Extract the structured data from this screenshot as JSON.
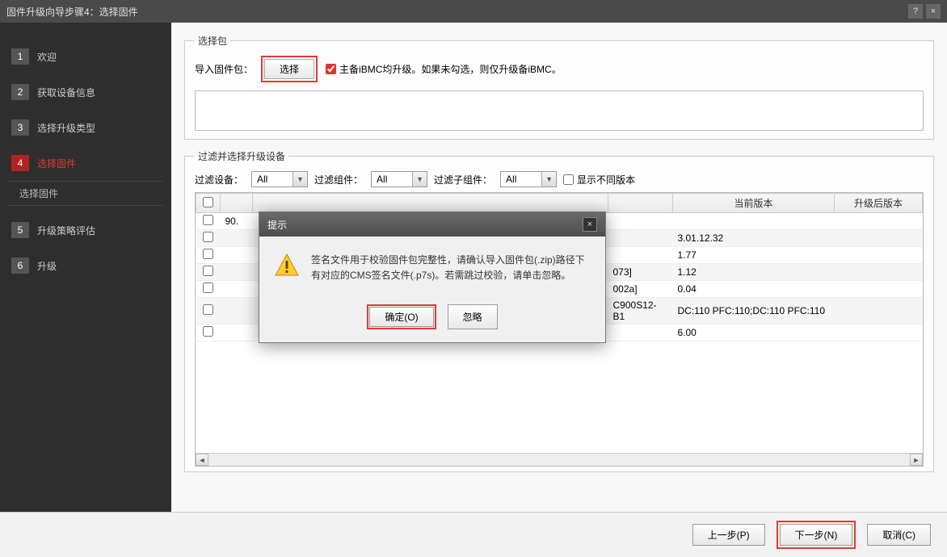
{
  "window": {
    "title": "固件升级向导步骤4：选择固件"
  },
  "sidebar": {
    "steps": [
      {
        "num": "1",
        "label": "欢迎"
      },
      {
        "num": "2",
        "label": "获取设备信息"
      },
      {
        "num": "3",
        "label": "选择升级类型"
      },
      {
        "num": "4",
        "label": "选择固件"
      },
      {
        "num": "5",
        "label": "升级策略评估"
      },
      {
        "num": "6",
        "label": "升级"
      }
    ],
    "substep": "选择固件"
  },
  "selectPackage": {
    "legend": "选择包",
    "importLabel": "导入固件包：",
    "selectBtn": "选择",
    "checkboxLabel": "主备iBMC均升级。如果未勾选，则仅升级备iBMC。",
    "checkboxChecked": true
  },
  "filterSection": {
    "legend": "过滤并选择升级设备",
    "filterDevice": "过滤设备：",
    "filterComponent": "过滤组件：",
    "filterSubComponent": "过滤子组件：",
    "showDiffVersion": "显示不同版本",
    "allOption": "All"
  },
  "table": {
    "headers": {
      "currentVersion": "当前版本",
      "upgradedVersion": "升级后版本"
    },
    "rows": [
      {
        "c1": "90.",
        "c4": "",
        "c5": ""
      },
      {
        "c1": "",
        "c4": "3.01.12.32",
        "c5": ""
      },
      {
        "c1": "",
        "c4": "1.77",
        "c5": ""
      },
      {
        "c1": "",
        "c3": "073]",
        "c4": "1.12",
        "c5": ""
      },
      {
        "c1": "",
        "c3": "002a]",
        "c4": "0.04",
        "c5": ""
      },
      {
        "c1": "",
        "c3": "C900S12-B1",
        "c4": "DC:110 PFC:110;DC:110 PFC:110",
        "c5": ""
      },
      {
        "c1": "",
        "c4": "6.00",
        "c5": ""
      }
    ]
  },
  "dialog": {
    "title": "提示",
    "message": "签名文件用于校验固件包完整性，请确认导入固件包(.zip)路径下有对应的CMS签名文件(.p7s)。若需跳过校验，请单击忽略。",
    "okBtn": "确定(O)",
    "ignoreBtn": "忽略"
  },
  "footer": {
    "prev": "上一步(P)",
    "next": "下一步(N)",
    "cancel": "取消(C)"
  }
}
